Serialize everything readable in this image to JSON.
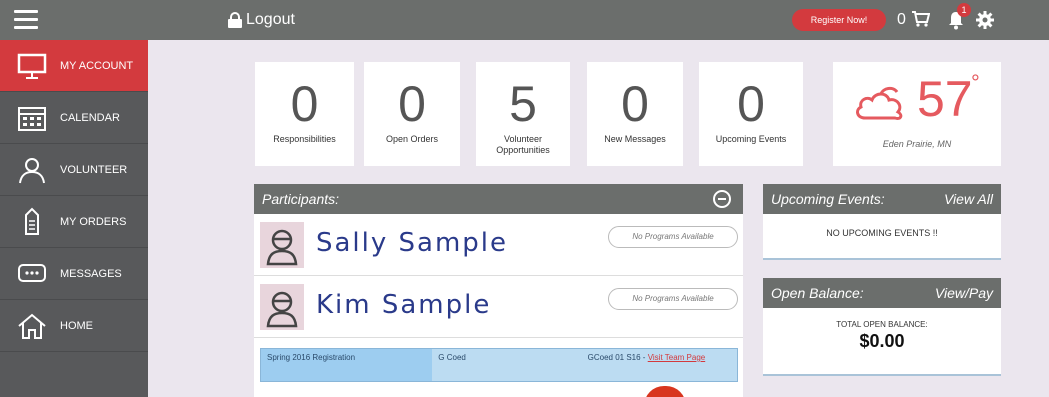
{
  "topbar": {
    "logout_label": "Logout",
    "register_label": "Register Now!",
    "cart_count": "0",
    "notification_count": "1"
  },
  "sidebar": {
    "items": [
      {
        "label": "MY ACCOUNT",
        "icon": "monitor-icon",
        "active": true
      },
      {
        "label": "CALENDAR",
        "icon": "calendar-icon",
        "active": false
      },
      {
        "label": "VOLUNTEER",
        "icon": "person-icon",
        "active": false
      },
      {
        "label": "MY ORDERS",
        "icon": "receipt-icon",
        "active": false
      },
      {
        "label": "MESSAGES",
        "icon": "chat-icon",
        "active": false
      },
      {
        "label": "HOME",
        "icon": "home-icon",
        "active": false
      }
    ]
  },
  "stats": [
    {
      "value": "0",
      "label": "Responsibilities"
    },
    {
      "value": "0",
      "label": "Open Orders"
    },
    {
      "value": "5",
      "label": "Volunteer Opportunities"
    },
    {
      "value": "0",
      "label": "New Messages"
    },
    {
      "value": "0",
      "label": "Upcoming Events"
    }
  ],
  "weather": {
    "temperature": "57",
    "degree": "°",
    "location": "Eden Prairie, MN"
  },
  "participants": {
    "title": "Participants:",
    "rows": [
      {
        "name": "Sally Sample",
        "status": "No Programs Available"
      },
      {
        "name": "Kim Sample",
        "status": "No Programs Available"
      }
    ],
    "registration": {
      "program": "Spring 2016 Registration",
      "division": "G Coed",
      "team": "GCoed 01 S16 - ",
      "link": "Visit Team Page"
    }
  },
  "upcoming_events": {
    "title": "Upcoming Events:",
    "view_all": "View All",
    "empty": "NO UPCOMING EVENTS !!"
  },
  "open_balance": {
    "title": "Open Balance:",
    "view_pay": "View/Pay",
    "label": "TOTAL OPEN BALANCE:",
    "amount": "$0.00"
  },
  "colors": {
    "accent": "#d33a3e",
    "topbar": "#6b6e6c",
    "sidebar": "#58595b"
  }
}
